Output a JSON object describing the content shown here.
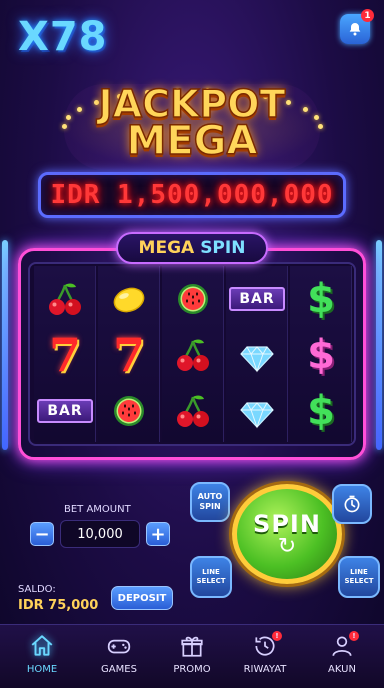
{
  "header": {
    "logo": "X78",
    "notification_badge": "1"
  },
  "jackpot": {
    "line1": "JACKPOT",
    "line2": "MEGA",
    "amount": "IDR 1,500,000,000"
  },
  "mega_spin": {
    "word1": "MEGA",
    "word2": "SPIN"
  },
  "reels": [
    [
      "cherry",
      "seven",
      "bar"
    ],
    [
      "lemon",
      "seven",
      "watermelon"
    ],
    [
      "watermelon",
      "cherry",
      "cherry"
    ],
    [
      "bar",
      "diamond",
      "diamond"
    ],
    [
      "dollar",
      "dollar-pink",
      "dollar"
    ]
  ],
  "symbols": {
    "bar_label": "BAR",
    "seven_label": "7",
    "dollar_label": "$"
  },
  "controls": {
    "bet_label": "BET AMOUNT",
    "bet_value": "10,000",
    "minus": "−",
    "plus": "+",
    "auto_spin_line1": "AUTO",
    "auto_spin_line2": "SPIN",
    "spin_label": "SPIN",
    "line_select_line1": "LINE",
    "line_select_line2": "SELECT"
  },
  "balance": {
    "label": "SALDO:",
    "value": "IDR 75,000",
    "deposit_label": "DEPOSIT"
  },
  "nav": {
    "items": [
      {
        "label": "HOME",
        "icon": "home-icon",
        "active": true
      },
      {
        "label": "GAMES",
        "icon": "gamepad-icon"
      },
      {
        "label": "PROMO",
        "icon": "gift-icon"
      },
      {
        "label": "RIWAYAT",
        "icon": "history-icon",
        "badge": "!"
      },
      {
        "label": "AKUN",
        "icon": "user-icon",
        "badge": "!"
      }
    ]
  },
  "colors": {
    "accent_blue": "#6ad8ff",
    "jackpot_gold": "#ffd65a",
    "led_red": "#ff3838",
    "neon_pink": "#ff4fd8",
    "spin_green": "#4cc024"
  }
}
